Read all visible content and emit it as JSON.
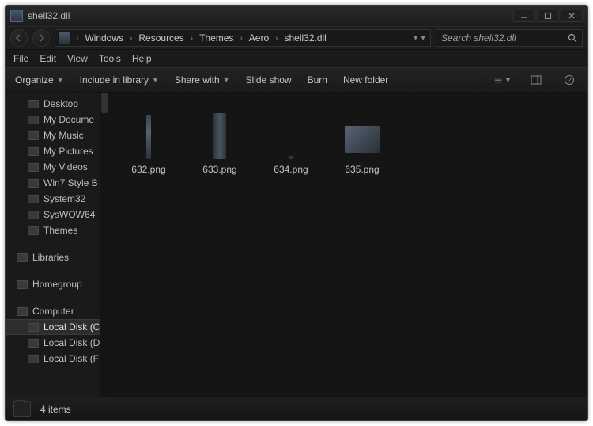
{
  "window": {
    "title": "shell32.dll"
  },
  "breadcrumb": {
    "segments": [
      "Windows",
      "Resources",
      "Themes",
      "Aero",
      "shell32.dll"
    ]
  },
  "search": {
    "placeholder": "Search shell32.dll"
  },
  "menubar": {
    "items": [
      "File",
      "Edit",
      "View",
      "Tools",
      "Help"
    ]
  },
  "toolbar": {
    "organize": "Organize",
    "include": "Include in library",
    "share": "Share with",
    "slideshow": "Slide show",
    "burn": "Burn",
    "newfolder": "New folder"
  },
  "sidebar": {
    "favorites": {
      "items": [
        {
          "label": "Desktop"
        },
        {
          "label": "My Docume"
        },
        {
          "label": "My Music"
        },
        {
          "label": "My Pictures"
        },
        {
          "label": "My Videos"
        },
        {
          "label": "Win7 Style B"
        },
        {
          "label": "System32"
        },
        {
          "label": "SysWOW64"
        },
        {
          "label": "Themes"
        }
      ]
    },
    "libraries": {
      "label": "Libraries"
    },
    "homegroup": {
      "label": "Homegroup"
    },
    "computer": {
      "label": "Computer",
      "items": [
        {
          "label": "Local Disk (C",
          "selected": true
        },
        {
          "label": "Local Disk (D"
        },
        {
          "label": "Local Disk (F"
        }
      ]
    }
  },
  "files": [
    {
      "name": "632.png",
      "thumb": "img1"
    },
    {
      "name": "633.png",
      "thumb": "img2"
    },
    {
      "name": "634.png",
      "thumb": "img3"
    },
    {
      "name": "635.png",
      "thumb": "img4"
    }
  ],
  "status": {
    "count": "4 items"
  }
}
